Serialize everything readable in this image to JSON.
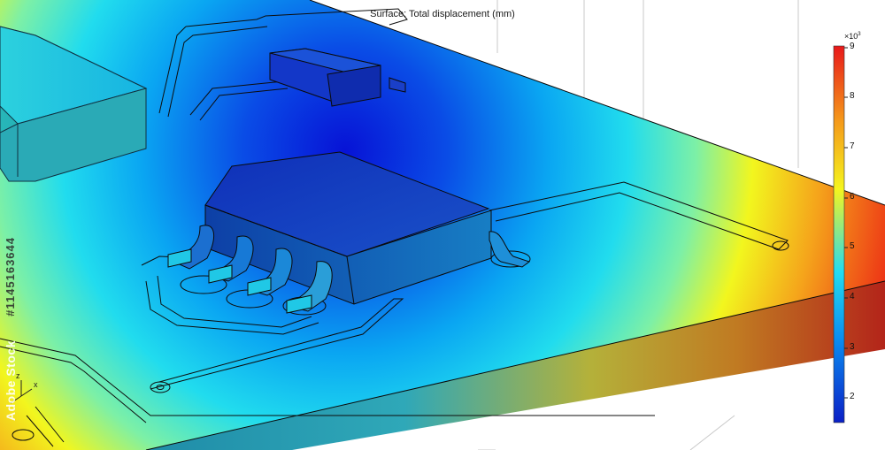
{
  "title": "Surface: Total displacement (mm)",
  "colorbar": {
    "exponent_base": "×10",
    "exponent_power": "3",
    "ticks": [
      "9",
      "8",
      "7",
      "6",
      "5",
      "4",
      "3",
      "2"
    ],
    "stops": [
      "#0a1fc6",
      "#0a8cf0",
      "#23dcf0",
      "#f5f51e",
      "#f59a1a",
      "#e8181a"
    ]
  },
  "watermark": {
    "id": "#1145163644",
    "brand": "Adobe Stock"
  },
  "axis_triad": {
    "x": "x",
    "z": "z"
  }
}
